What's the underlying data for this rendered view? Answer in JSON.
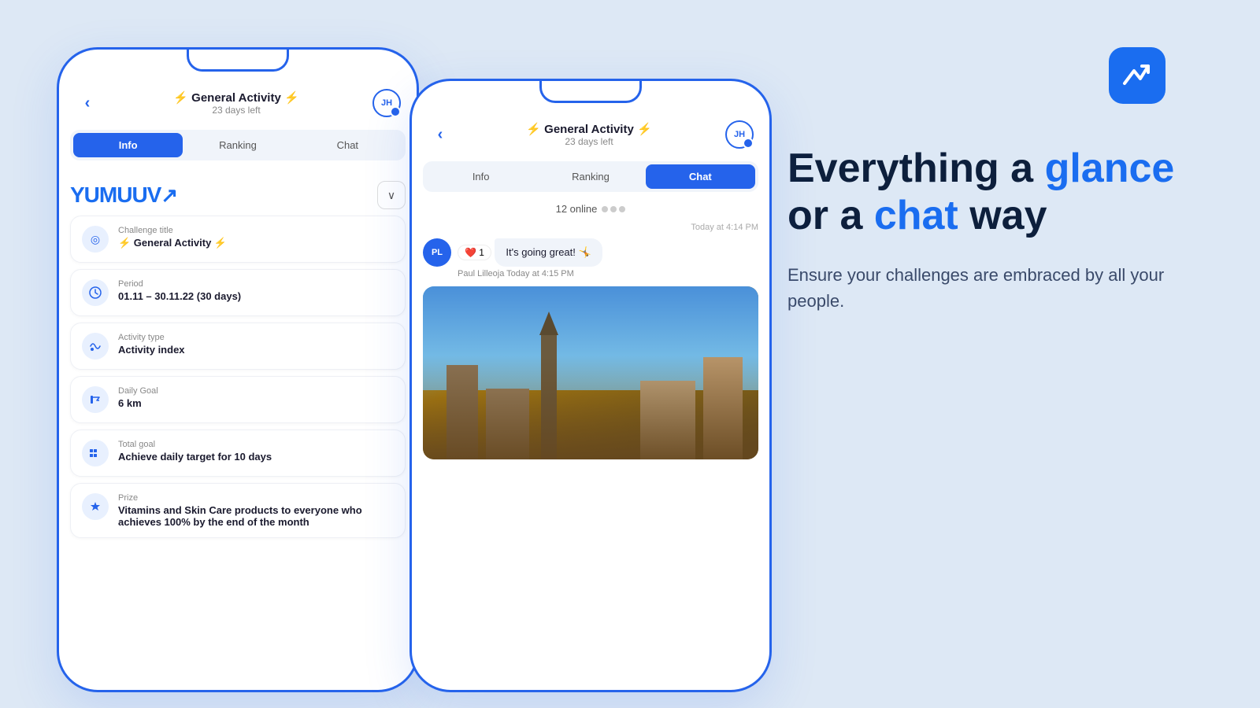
{
  "appLogo": {
    "symbol": "✓↗"
  },
  "headline": {
    "line1": "Everything a ",
    "highlight1": "glance",
    "line2": " or a ",
    "highlight2": "chat",
    "line3": " way",
    "subtext": "Ensure your challenges are embraced by all your people."
  },
  "phone1": {
    "backLabel": "‹",
    "title": "⚡ General Activity ⚡",
    "subtitle": "23 days left",
    "avatarLabel": "JH",
    "tabs": [
      {
        "label": "Info",
        "active": true
      },
      {
        "label": "Ranking",
        "active": false
      },
      {
        "label": "Chat",
        "active": false
      }
    ],
    "brandName": "YUMUUV",
    "chevronLabel": "∨",
    "cards": [
      {
        "icon": "◎",
        "label": "Challenge title",
        "value": "⚡ General Activity ⚡"
      },
      {
        "icon": "🕐",
        "label": "Period",
        "value": "01.11 – 30.11.22 (30 days)"
      },
      {
        "icon": "∿",
        "label": "Activity type",
        "value": "Activity index"
      },
      {
        "icon": "⚑",
        "label": "Daily Goal",
        "value": "6 km"
      },
      {
        "icon": "▦",
        "label": "Total goal",
        "value": "Achieve daily target for 10 days"
      },
      {
        "icon": "🏆",
        "label": "Prize",
        "value": "Vitamins and Skin Care products to everyone who achieves 100% by the end of the month"
      }
    ]
  },
  "phone2": {
    "backLabel": "‹",
    "title": "⚡ General Activity ⚡",
    "subtitle": "23 days left",
    "avatarLabel": "JH",
    "tabs": [
      {
        "label": "Info",
        "active": false
      },
      {
        "label": "Ranking",
        "active": false
      },
      {
        "label": "Chat",
        "active": true
      }
    ],
    "onlineCount": "12 online",
    "timestampLabel": "Today at 4:14 PM",
    "reaction": "❤️  1",
    "message": "It's going great! 🤸",
    "senderLabel": "Paul Lilleoja  Today at 4:15 PM",
    "chatAvatarLabel": "PL"
  }
}
